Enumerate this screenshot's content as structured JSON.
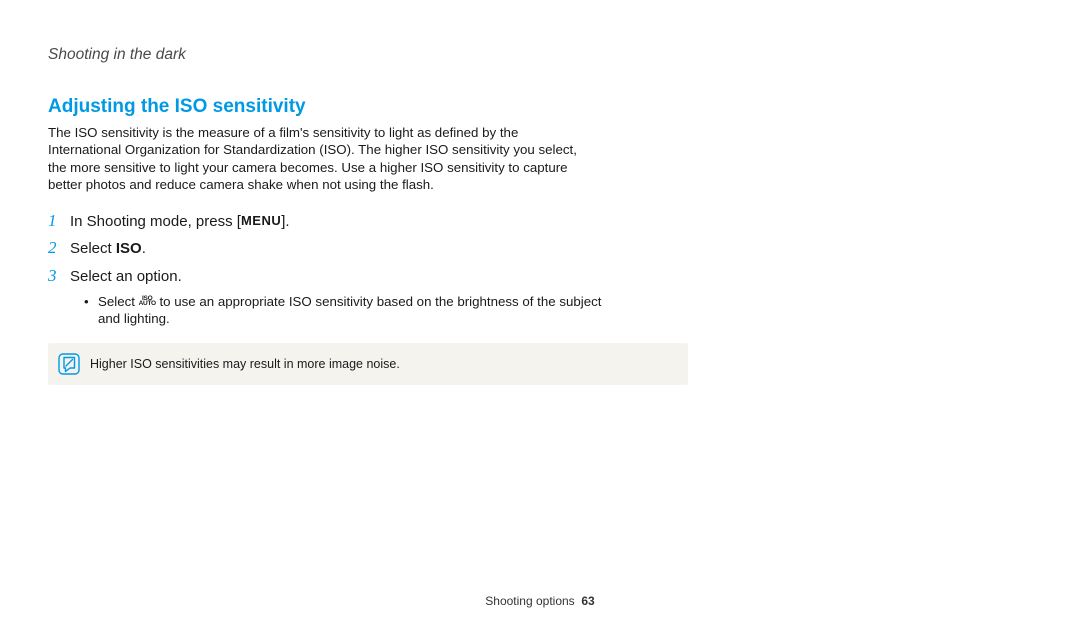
{
  "header": {
    "chapter": "Shooting in the dark"
  },
  "section": {
    "title": "Adjusting the ISO sensitivity",
    "intro": "The ISO sensitivity is the measure of a film's sensitivity to light as defined by the International Organization for Standardization (ISO). The higher ISO sensitivity you select, the more sensitive to light your camera becomes. Use a higher ISO sensitivity to capture better photos and reduce camera shake when not using the flash."
  },
  "steps": {
    "s1": {
      "num": "1",
      "pre": "In Shooting mode, press [",
      "menu": "MENU",
      "post": "]."
    },
    "s2": {
      "num": "2",
      "pre": "Select ",
      "bold": "ISO",
      "post": "."
    },
    "s3": {
      "num": "3",
      "text": "Select an option."
    },
    "sub": {
      "pre": "Select ",
      "post": " to use an appropriate ISO sensitivity based on the brightness of the subject and lighting."
    }
  },
  "note": {
    "text": "Higher ISO sensitivities may result in more image noise."
  },
  "footer": {
    "label": "Shooting options",
    "page": "63"
  }
}
